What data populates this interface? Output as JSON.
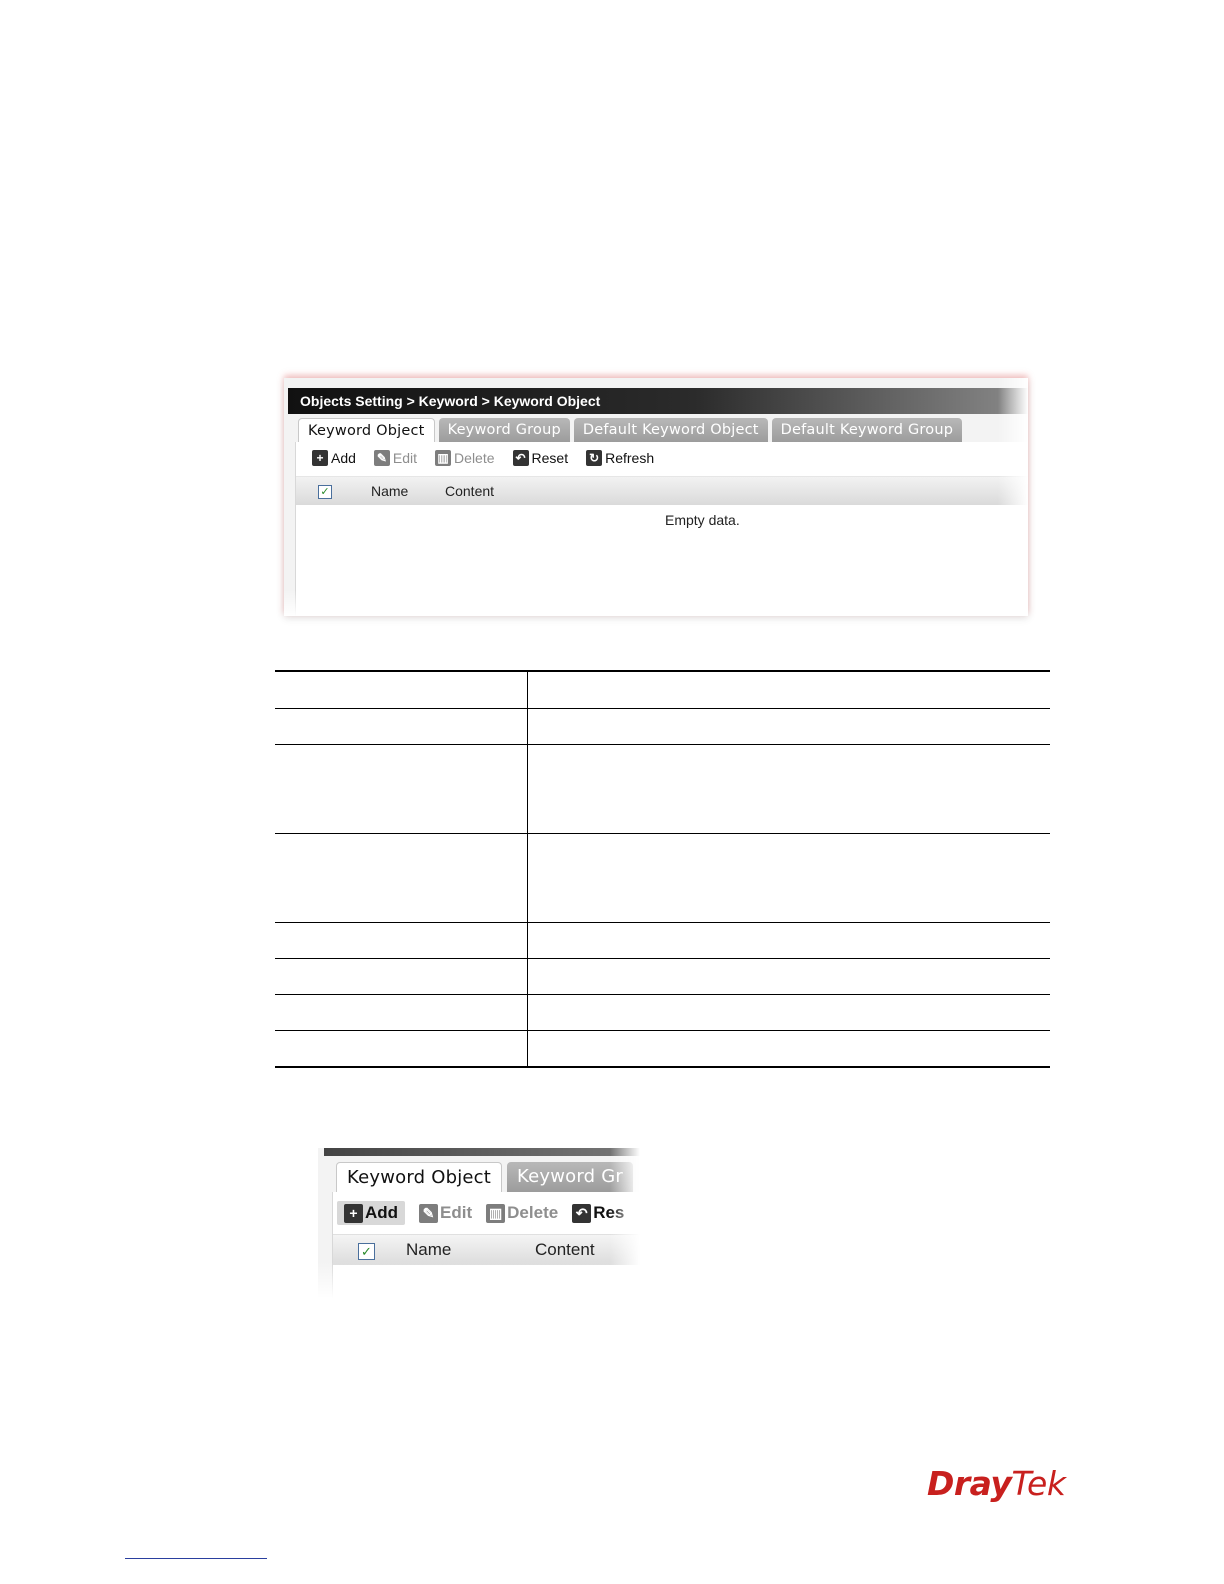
{
  "screenshot1": {
    "breadcrumb": "Objects Setting > Keyword > Keyword Object",
    "tabs": [
      {
        "label": "Keyword Object",
        "active": true
      },
      {
        "label": "Keyword Group",
        "active": false
      },
      {
        "label": "Default Keyword Object",
        "active": false
      },
      {
        "label": "Default Keyword Group",
        "active": false
      }
    ],
    "toolbar": {
      "add": "Add",
      "edit": "Edit",
      "delete": "Delete",
      "reset": "Reset",
      "refresh": "Refresh"
    },
    "columns": {
      "checkbox": "✓",
      "name": "Name",
      "content": "Content"
    },
    "empty_message": "Empty data."
  },
  "table": {
    "rows": [
      {
        "item": "",
        "description": ""
      },
      {
        "item": "",
        "description": ""
      },
      {
        "item": "",
        "description": ""
      },
      {
        "item": "",
        "description": ""
      },
      {
        "item": "",
        "description": ""
      },
      {
        "item": "",
        "description": ""
      },
      {
        "item": "",
        "description": ""
      },
      {
        "item": "",
        "description": ""
      }
    ]
  },
  "screenshot2": {
    "tabs": [
      {
        "label": "Keyword Object",
        "active": true
      },
      {
        "label": "Keyword Gr",
        "active": false
      }
    ],
    "toolbar": {
      "add": "Add",
      "edit": "Edit",
      "delete": "Delete",
      "reset": "Res"
    },
    "columns": {
      "checkbox": "✓",
      "name": "Name",
      "content": "Content"
    }
  },
  "footer": {
    "logo_part1": "Dray",
    "logo_part2": "Tek",
    "accent_color": "#c8201e"
  }
}
